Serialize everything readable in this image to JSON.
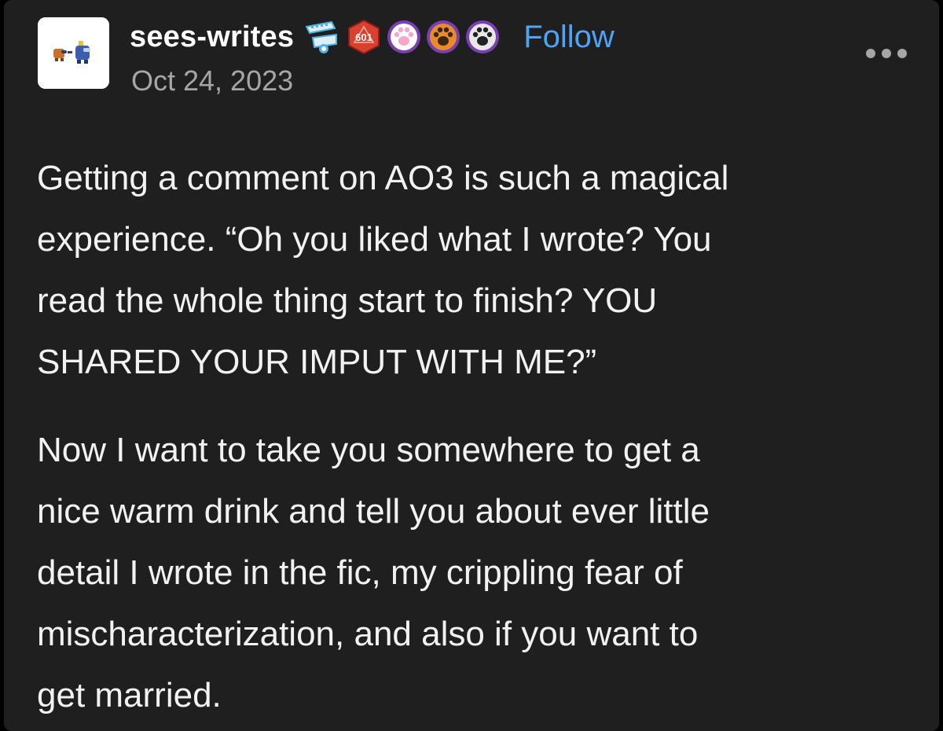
{
  "post": {
    "username": "sees-writes",
    "date": "Oct 24, 2023",
    "follow_label": "Follow",
    "badges": [
      {
        "name": "robot-mouth-badge",
        "color": "#4fb0e6"
      },
      {
        "name": "d20-dice-badge",
        "color": "#d8402f",
        "text": "601"
      },
      {
        "name": "pink-paw-badge",
        "color": "#f7a6c8"
      },
      {
        "name": "orange-paw-badge",
        "color": "#e98b2a"
      },
      {
        "name": "black-paw-badge",
        "color": "#222222"
      }
    ],
    "more_icon": "ellipsis-icon",
    "paragraphs": [
      {
        "lines": [
          "Getting a comment on AO3 is such a magical",
          "experience. “Oh you liked what I wrote? You",
          "read the whole thing start to finish? YOU",
          "SHARED YOUR IMPUT WITH ME?”"
        ]
      },
      {
        "lines": [
          "Now I want to take you somewhere to get a",
          "nice warm drink and tell you about ever little",
          "detail I wrote in the fic, my crippling fear of",
          "mischaracterization, and also if you want to",
          "get married."
        ]
      }
    ]
  },
  "colors": {
    "background": "#1f1f1f",
    "username": "#ffffff",
    "date": "#a6a6a6",
    "follow": "#4fa3f7",
    "body_text": "#f2f2f2"
  }
}
